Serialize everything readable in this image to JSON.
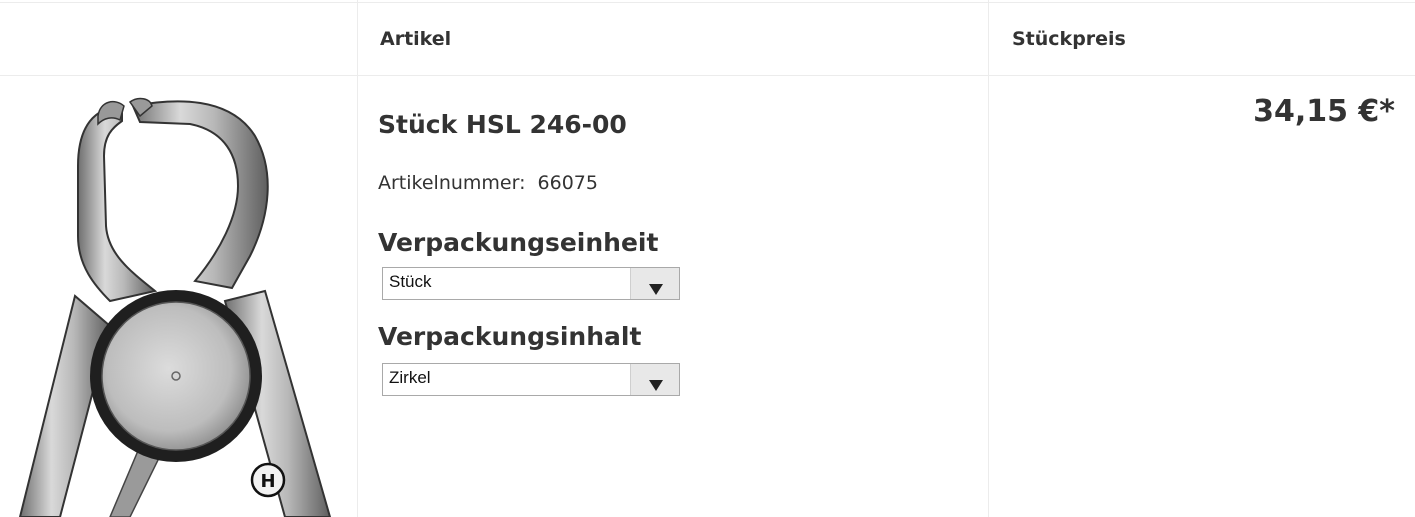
{
  "table": {
    "headers": {
      "artikel": "Artikel",
      "stueckpreis": "Stückpreis"
    }
  },
  "product": {
    "image_alt": "Stück HSL 246-00",
    "title": "Stück HSL 246-00",
    "article_number_label": "Artikelnummer:",
    "article_number": "66075",
    "price": "34,15 €*"
  },
  "options": {
    "verpackungseinheit": {
      "label": "Verpackungseinheit",
      "selected": "Stück"
    },
    "verpackungsinhalt": {
      "label": "Verpackungsinhalt",
      "selected": "Zirkel"
    }
  },
  "icons": {
    "dropdown": "chevron-down-icon",
    "brand_mark": "H"
  },
  "colors": {
    "text": "#333333",
    "border": "#ececec",
    "select_border": "#a9a9a9",
    "select_button": "#e8e8e8"
  }
}
